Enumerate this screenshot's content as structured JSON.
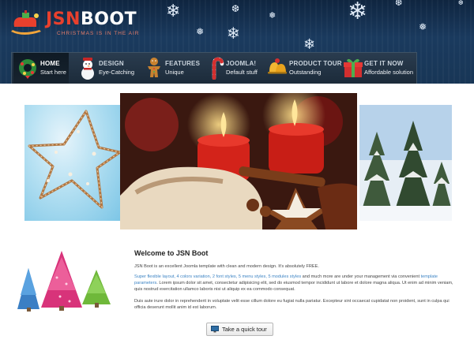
{
  "brand": {
    "name_prefix": "JSN",
    "name_suffix": "BOOT",
    "tagline": "CHRISTMAS IS IN THE AIR",
    "accent_color": "#e9402d"
  },
  "menu": {
    "items": [
      {
        "title": "HOME",
        "subtitle": "Start here",
        "icon": "wreath-icon",
        "active": true
      },
      {
        "title": "DESIGN",
        "subtitle": "Eye-Catching",
        "icon": "snowman-icon",
        "active": false
      },
      {
        "title": "FEATURES",
        "subtitle": "Unique",
        "icon": "gingerbread-man-icon",
        "active": false
      },
      {
        "title": "JOOMLA!",
        "subtitle": "Default stuff",
        "icon": "candy-cane-icon",
        "active": false
      },
      {
        "title": "PRODUCT TOUR",
        "subtitle": "Outstanding",
        "icon": "bells-icon",
        "active": false
      },
      {
        "title": "GET IT NOW",
        "subtitle": "Affordable solution",
        "icon": "gift-box-icon",
        "active": false
      }
    ]
  },
  "slideshow": {
    "slides": [
      "ornament-star-image",
      "candles-stollen-image",
      "snowy-trees-image"
    ]
  },
  "content": {
    "title": "Welcome to JSN Boot",
    "paragraph1": "JSN Boot is an excellent Joomla template with clean and modern design. It's absolutely FREE.",
    "paragraph2_highlight": "Super flexible layout, 4 colors variation, 2 font styles, 5 menu styles, 5 modules styles",
    "paragraph2_mid": " and much more are under your management via convenient ",
    "paragraph2_link": "template parameters",
    "paragraph2_rest": ". Lorem ipsum dolor sit amet, consectetur adipisicing elit, sed do eiusmod tempor incididunt ut labore et dolore magna aliqua. Ut enim ad minim veniam, quis nostrud exercitation ullamco laboris nisi ut aliquip ex ea commodo consequat.",
    "paragraph3": "Duis aute irure dolor in reprehenderit in voluptate velit esse cillum dolore eu fugiat nulla pariatur. Excepteur sint occaecat cupidatat non proident, sunt in culpa qui officia deserunt mollit anim id est laborum.",
    "tour_button": "Take a quick tour",
    "link_color": "#3d84c4"
  }
}
